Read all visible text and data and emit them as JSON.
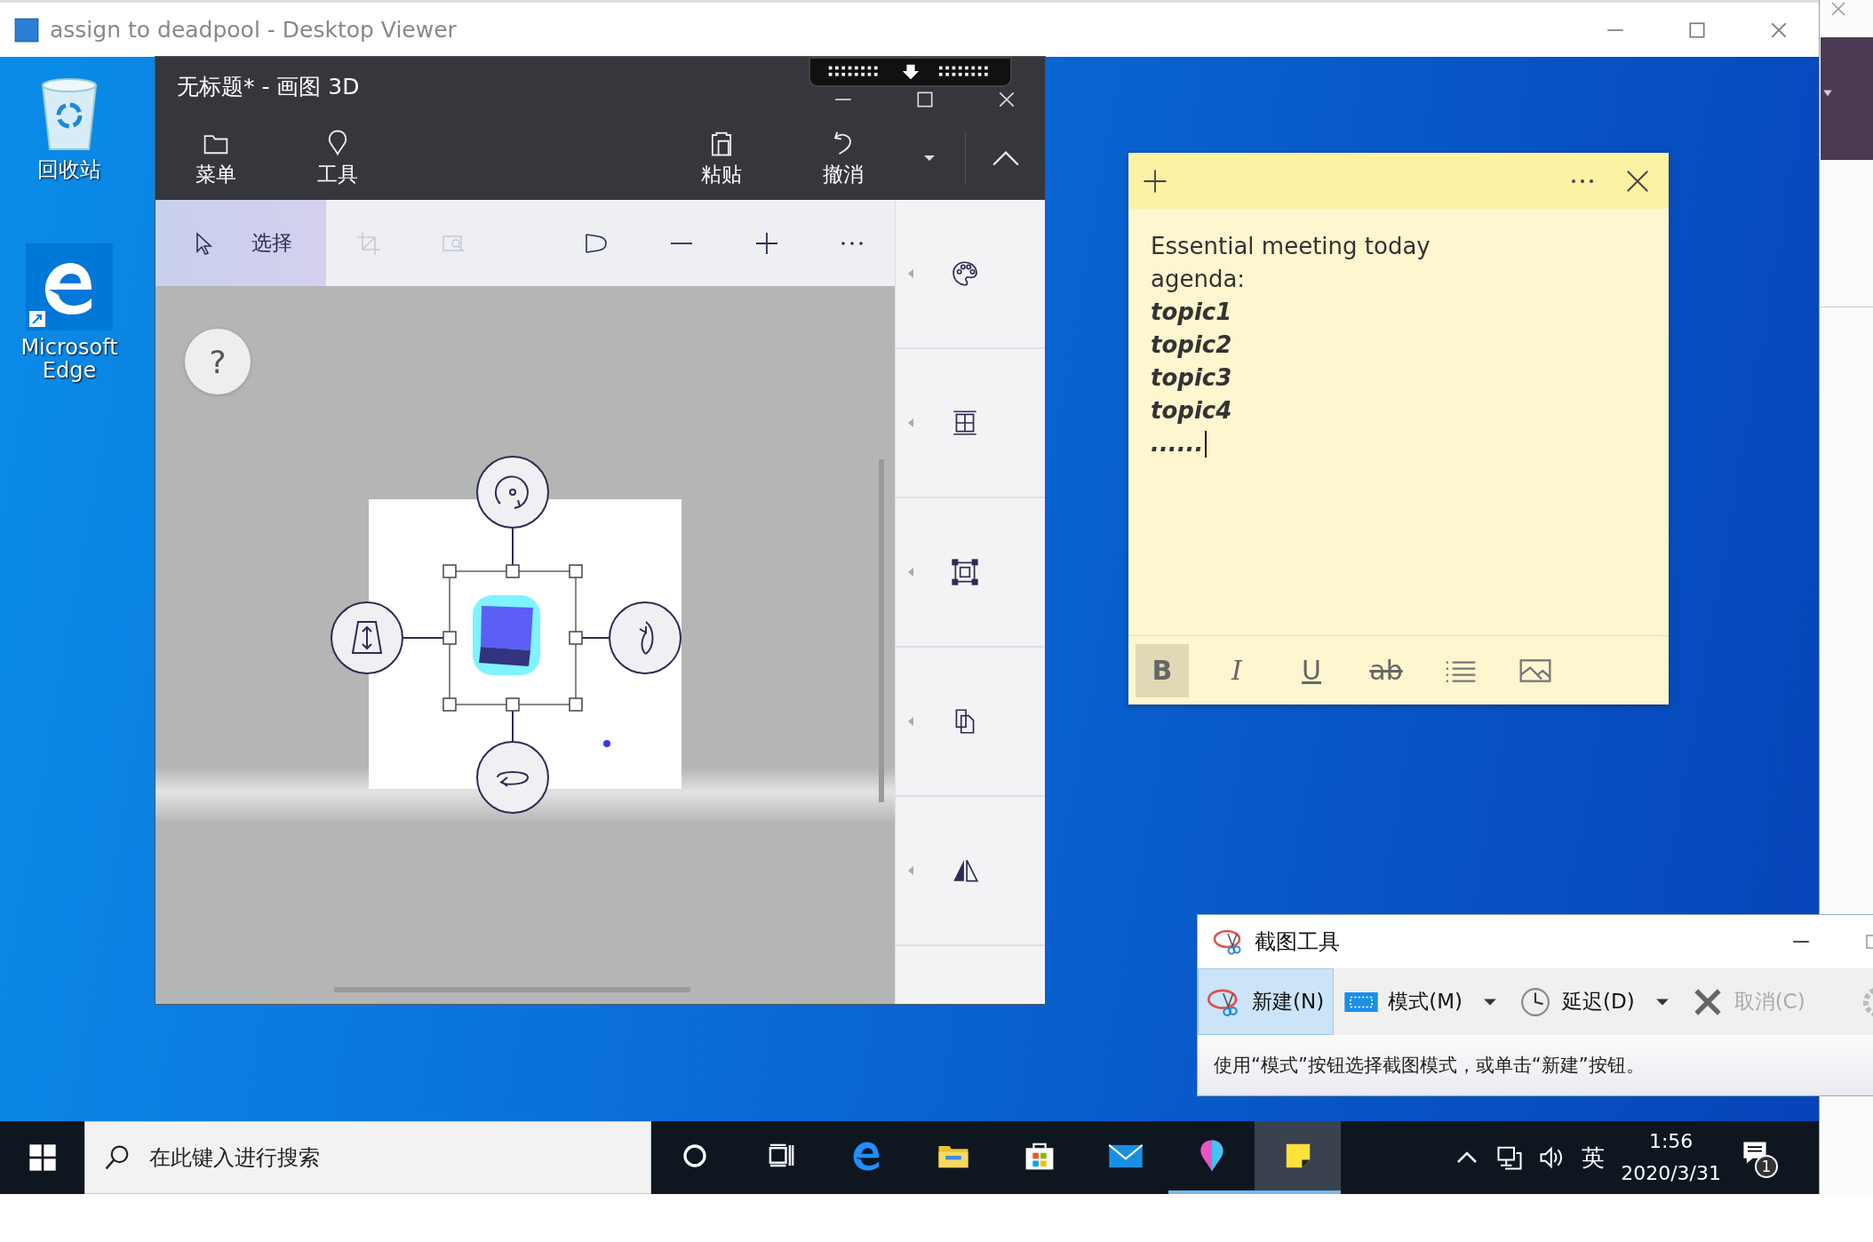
{
  "window": {
    "title": "assign to deadpool - Desktop Viewer"
  },
  "desktop_icons": [
    {
      "label": "回收站",
      "kind": "recycle"
    },
    {
      "label": "Microsoft Edge",
      "kind": "edge"
    }
  ],
  "paint3d": {
    "title": "无标题* - 画图 3D",
    "ribbon": [
      {
        "label": "菜单",
        "kind": "menu"
      },
      {
        "label": "工具",
        "kind": "tools"
      },
      {
        "label": "粘贴",
        "kind": "paste"
      },
      {
        "label": "撤消",
        "kind": "undo"
      }
    ],
    "tools": [
      {
        "label": "选择",
        "kind": "select",
        "selected": true,
        "disabled": false
      },
      {
        "kind": "crop",
        "selected": false,
        "disabled": true
      },
      {
        "kind": "magic-select",
        "selected": false,
        "disabled": true
      },
      {
        "kind": "view",
        "selected": false,
        "disabled": false
      },
      {
        "kind": "zoom-out",
        "selected": false,
        "disabled": false
      },
      {
        "kind": "zoom-in",
        "selected": false,
        "disabled": false
      },
      {
        "kind": "more",
        "selected": false,
        "disabled": false
      }
    ],
    "panel": [
      {
        "kind": "palette"
      },
      {
        "kind": "grid"
      },
      {
        "kind": "frame"
      },
      {
        "kind": "copy"
      },
      {
        "kind": "mirror"
      }
    ],
    "help": "?"
  },
  "sticky_note": {
    "lines": [
      {
        "text": "Essential meeting today",
        "emphasis": false
      },
      {
        "text": "agenda:",
        "emphasis": false
      },
      {
        "text": "topic1",
        "emphasis": true
      },
      {
        "text": "topic2",
        "emphasis": true
      },
      {
        "text": "topic3",
        "emphasis": true
      },
      {
        "text": "topic4",
        "emphasis": true
      },
      {
        "text": "......",
        "emphasis": true
      }
    ],
    "format_buttons": [
      {
        "label": "B",
        "kind": "bold",
        "selected": true
      },
      {
        "label": "I",
        "kind": "italic",
        "selected": false
      },
      {
        "label": "U",
        "kind": "underline",
        "selected": false
      },
      {
        "label": "ab",
        "kind": "strike",
        "selected": false
      },
      {
        "kind": "list",
        "selected": false
      },
      {
        "kind": "image",
        "selected": false
      }
    ]
  },
  "snipping_tool": {
    "title": "截图工具",
    "buttons": [
      {
        "label": "新建(N)",
        "kind": "new",
        "selected": true,
        "disabled": false
      },
      {
        "label": "模式(M)",
        "kind": "mode",
        "selected": false,
        "disabled": false,
        "dropdown": true
      },
      {
        "label": "延迟(D)",
        "kind": "delay",
        "selected": false,
        "disabled": false,
        "dropdown": true
      },
      {
        "label": "取消(C)",
        "kind": "cancel",
        "selected": false,
        "disabled": true
      }
    ],
    "status": "使用“模式”按钮选择截图模式，或单击“新建”按钮。"
  },
  "taskbar": {
    "search_placeholder": "在此键入进行搜索",
    "apps": [
      {
        "kind": "cortana",
        "open": false,
        "selected": false
      },
      {
        "kind": "taskview",
        "open": false,
        "selected": false
      },
      {
        "kind": "edge",
        "open": false,
        "selected": false
      },
      {
        "kind": "explorer",
        "open": false,
        "selected": false
      },
      {
        "kind": "store",
        "open": false,
        "selected": false
      },
      {
        "kind": "mail",
        "open": false,
        "selected": false
      },
      {
        "kind": "paint3d",
        "open": true,
        "selected": false
      },
      {
        "kind": "sticky",
        "open": true,
        "selected": true
      }
    ],
    "ime": "英",
    "time": "1:56",
    "date": "2020/3/31",
    "notifications": "1"
  }
}
